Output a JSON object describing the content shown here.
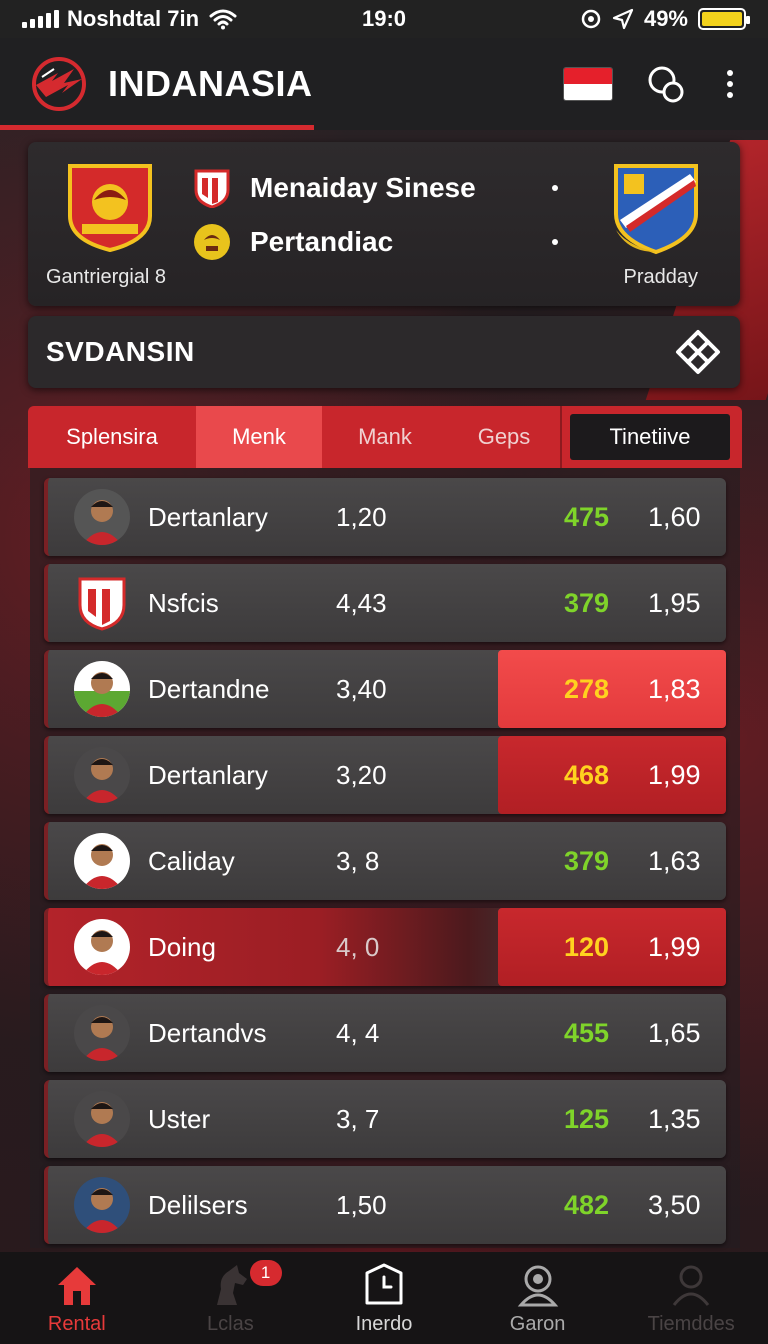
{
  "status_bar": {
    "carrier": "Noshdtal 7in",
    "time": "19:0",
    "battery": "49%"
  },
  "header": {
    "title": "INDANASIA",
    "logo_icon": "mascot-logo-icon",
    "flag_icon": "indonesia-flag-icon",
    "action_icon": "search-bubbles-icon",
    "menu_icon": "kebab-menu-icon"
  },
  "match": {
    "home_caption": "Gantriergial 8",
    "away_caption": "Pradday",
    "rows": [
      {
        "label": "Menaiday Sinese"
      },
      {
        "label": "Pertandiac"
      }
    ]
  },
  "section": {
    "title": "SVDANSIN",
    "icon": "close-x-icon"
  },
  "tabs": [
    {
      "label": "Splensira"
    },
    {
      "label": "Menk"
    },
    {
      "label": "Mank"
    },
    {
      "label": "Geps"
    },
    {
      "label": "Tinetiive"
    }
  ],
  "rows": [
    {
      "name": "Dertanlary",
      "v1": "1,20",
      "v2": "475",
      "v3": "1,60"
    },
    {
      "name": "Nsfcis",
      "v1": "4,43",
      "v2": "379",
      "v3": "1,95"
    },
    {
      "name": "Dertandne",
      "v1": "3,40",
      "v2": "278",
      "v3": "1,83"
    },
    {
      "name": "Dertanlary",
      "v1": "3,20",
      "v2": "468",
      "v3": "1,99"
    },
    {
      "name": "Caliday",
      "v1": "3,  8",
      "v2": "379",
      "v3": "1,63"
    },
    {
      "name": "Doing",
      "v1": "4,  0",
      "v2": "120",
      "v3": "1,99"
    },
    {
      "name": "Dertandvs",
      "v1": "4,  4",
      "v2": "455",
      "v3": "1,65"
    },
    {
      "name": "Uster",
      "v1": "3,  7",
      "v2": "125",
      "v3": "1,35"
    },
    {
      "name": "Delilsers",
      "v1": "1,50",
      "v2": "482",
      "v3": "3,50"
    }
  ],
  "bottom_nav": [
    {
      "label": "Rental",
      "icon": "home-icon"
    },
    {
      "label": "Lclas",
      "icon": "horse-icon",
      "badge": "1"
    },
    {
      "label": "Inerdo",
      "icon": "clock-box-icon"
    },
    {
      "label": "Garon",
      "icon": "user-icon"
    },
    {
      "label": "Tiemddes",
      "icon": "profile-icon"
    }
  ],
  "colors": {
    "accent": "#d52a2f",
    "positive": "#7fd42a",
    "highlight_value": "#ffd21f"
  }
}
